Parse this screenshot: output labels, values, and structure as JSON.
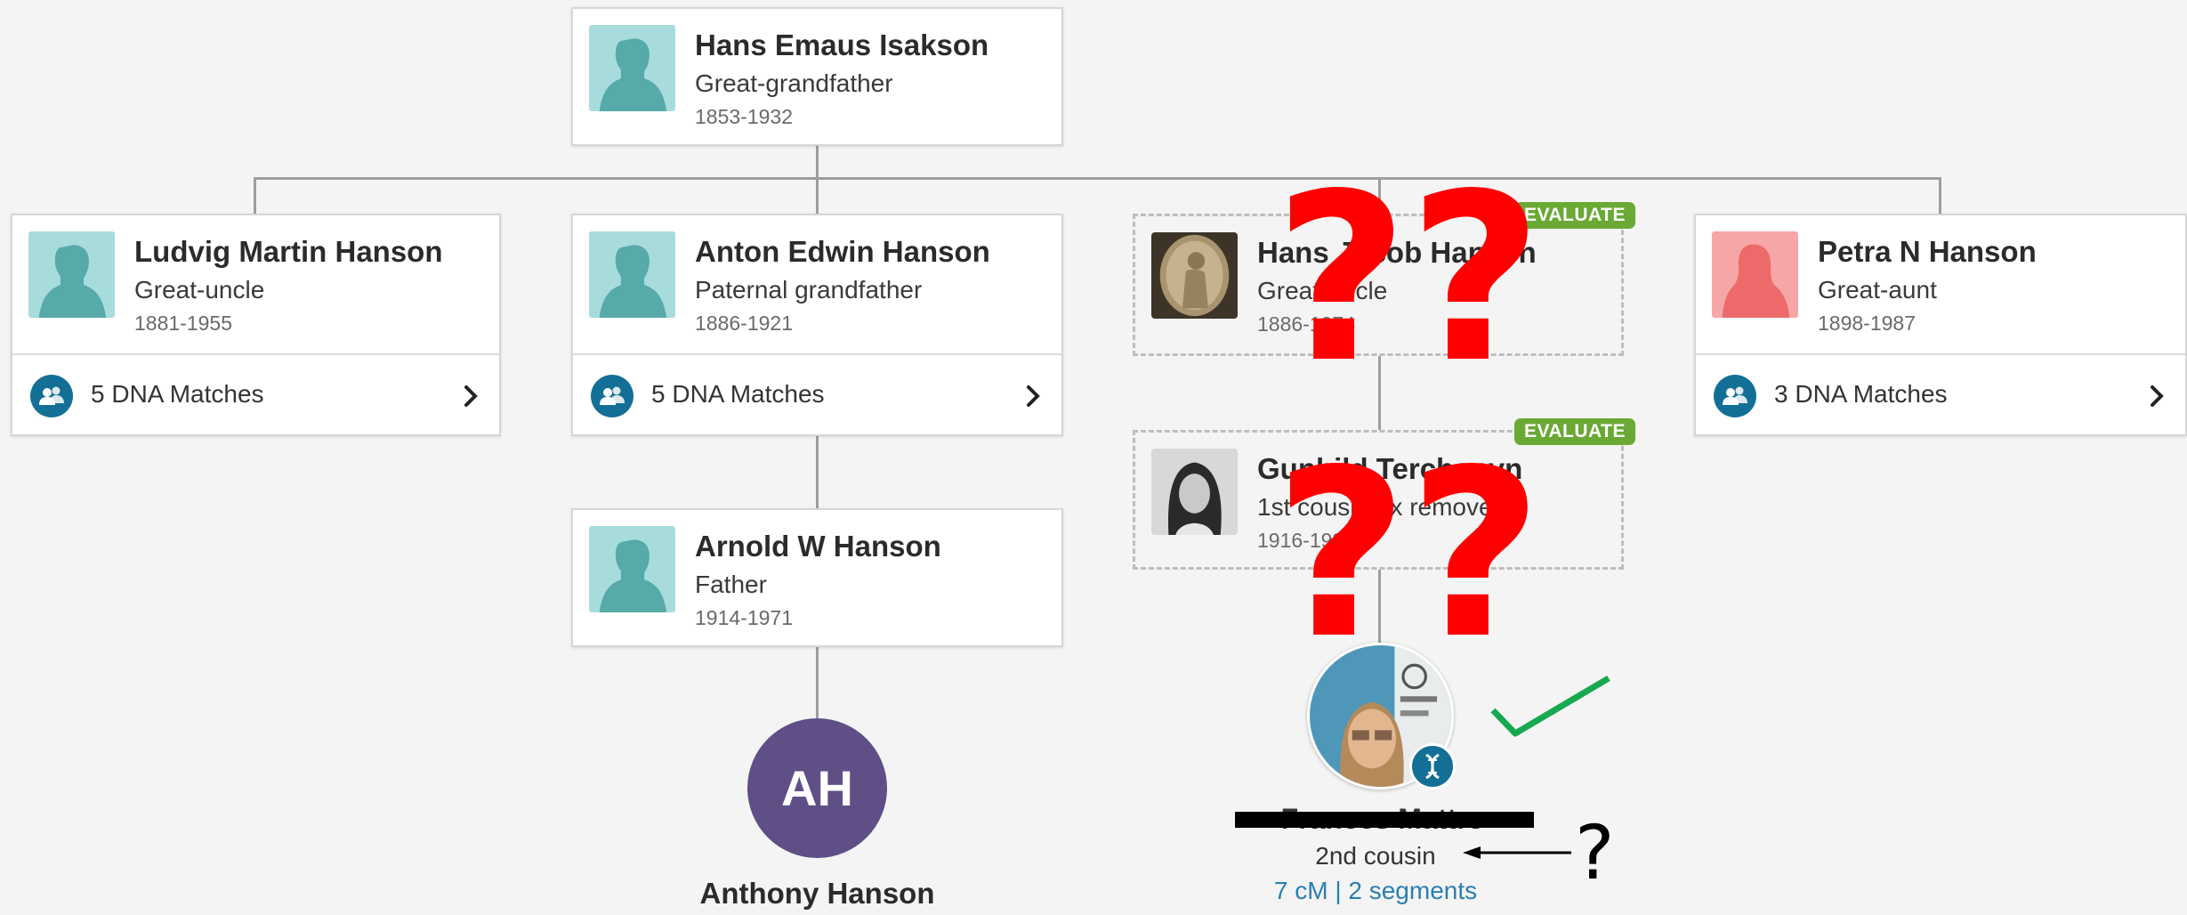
{
  "top_person": {
    "name": "Hans Emaus Isakson",
    "relationship": "Great-grandfather",
    "dates": "1853-1932"
  },
  "siblings": [
    {
      "name": "Ludvig Martin Hanson",
      "relationship": "Great-uncle",
      "dates": "1881-1955",
      "matches": "5 DNA Matches"
    },
    {
      "name": "Anton Edwin Hanson",
      "relationship": "Paternal grandfather",
      "dates": "1886-1921",
      "matches": "5 DNA Matches"
    },
    {
      "name": "Hans Jacob Hansen",
      "relationship": "Great-uncle",
      "dates": "1886-1974",
      "badge": "EVALUATE"
    },
    {
      "name": "Petra N Hanson",
      "relationship": "Great-aunt",
      "dates": "1898-1987",
      "matches": "3 DNA Matches"
    }
  ],
  "father": {
    "name": "Arnold W Hanson",
    "relationship": "Father",
    "dates": "1914-1971"
  },
  "cousin": {
    "name": "Gunhild Terchanyn",
    "relationship": "1st cousin 1x removed",
    "dates": "1916-1986",
    "badge": "EVALUATE"
  },
  "self": {
    "initials": "AH",
    "name": "Anthony Hanson"
  },
  "dna_match": {
    "name": "Frances Mattre",
    "relationship": "2nd cousin",
    "shared": "7 cM | 2 segments"
  },
  "annotations": {
    "question_mark": "?",
    "question_marks": "??"
  },
  "colors": {
    "avatar_male": "#a8dcdc",
    "avatar_female": "#f6a6a6",
    "dna_blue": "#146f96",
    "badge_green": "#6aa934",
    "self_purple": "#5f4f86",
    "link_blue": "#2a7fb0",
    "annotation_red": "#ff0000",
    "check_green": "#17a94f"
  },
  "icons": {
    "avatar": "person-silhouette-icon",
    "matches": "dna-matches-icon",
    "chevron": "chevron-right-icon",
    "dna": "dna-icon",
    "check": "checkmark-icon",
    "arrow": "arrow-left-icon"
  }
}
